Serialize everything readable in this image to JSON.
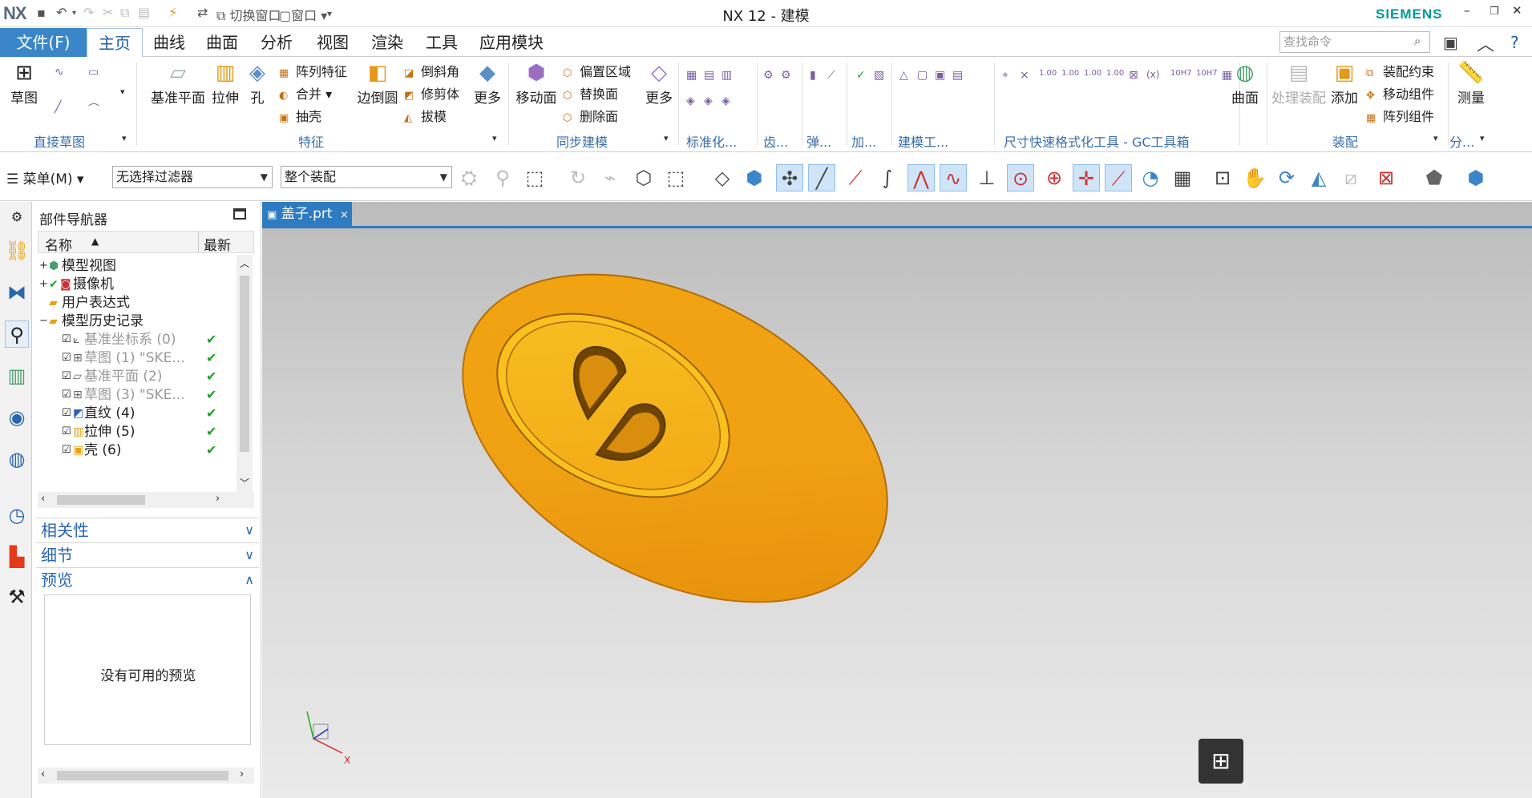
{
  "titlebar": {
    "logo": "NX",
    "title": "NX 12 - 建模",
    "brand": "SIEMENS",
    "switch_window": "切换窗口",
    "window_menu": "窗口"
  },
  "ribbon_tabs": {
    "file": "文件(F)",
    "tabs": [
      "主页",
      "曲线",
      "曲面",
      "分析",
      "视图",
      "渲染",
      "工具",
      "应用模块"
    ],
    "search_placeholder": "查找命令"
  },
  "ribbon": {
    "sketch": "草图",
    "datum_plane": "基准平面",
    "extrude": "拉伸",
    "hole": "孔",
    "pattern_feature": "阵列特征",
    "unite": "合并",
    "shell": "抽壳",
    "edge_blend": "边倒圆",
    "chamfer": "倒斜角",
    "trim_body": "修剪体",
    "draft": "拔模",
    "more1": "更多",
    "move_face": "移动面",
    "offset_region": "偏置区域",
    "replace_face": "替换面",
    "delete_face": "删除面",
    "more2": "更多",
    "surface": "曲面",
    "process_assembly": "处理装配",
    "add": "添加",
    "assembly_constraint": "装配约束",
    "move_component": "移动组件",
    "pattern_component": "阵列组件",
    "measure": "测量",
    "groups": {
      "direct_sketch": "直接草图",
      "feature": "特征",
      "sync_modeling": "同步建模",
      "standardize": "标准化...",
      "gear": "齿...",
      "spring": "弹...",
      "add_group": "加...",
      "modeling_tools": "建模工...",
      "gc_toolbox": "尺寸快速格式化工具 - GC工具箱",
      "assembly": "装配",
      "analysis": "分..."
    }
  },
  "topbar": {
    "menu": "菜单(M)",
    "filter": "无选择过滤器",
    "scope": "整个装配"
  },
  "navigator": {
    "title": "部件导航器",
    "col_name": "名称",
    "col_latest": "最新",
    "rows": [
      {
        "label": "模型视图",
        "dim": false,
        "check": ""
      },
      {
        "label": "摄像机",
        "dim": false,
        "check": ""
      },
      {
        "label": "用户表达式",
        "dim": false,
        "check": ""
      },
      {
        "label": "模型历史记录",
        "dim": false,
        "check": ""
      },
      {
        "label": "基准坐标系 (0)",
        "dim": true,
        "check": "✔"
      },
      {
        "label": "草图 (1) \"SKE...",
        "dim": true,
        "check": "✔"
      },
      {
        "label": "基准平面 (2)",
        "dim": true,
        "check": "✔"
      },
      {
        "label": "草图 (3) \"SKE...",
        "dim": true,
        "check": "✔"
      },
      {
        "label": "直纹 (4)",
        "dim": false,
        "check": "✔"
      },
      {
        "label": "拉伸 (5)",
        "dim": false,
        "check": "✔"
      },
      {
        "label": "壳 (6)",
        "dim": false,
        "check": "✔"
      }
    ],
    "sections": {
      "dependencies": "相关性",
      "details": "细节",
      "preview": "预览"
    },
    "preview_empty": "没有可用的预览"
  },
  "graphics": {
    "doc_tab": "盖子.prt",
    "triad_x": "X"
  },
  "colors": {
    "accent": "#3a86c8",
    "model_face": "#f4a20f",
    "model_top": "#ffc21a",
    "check": "#1fa02a"
  }
}
